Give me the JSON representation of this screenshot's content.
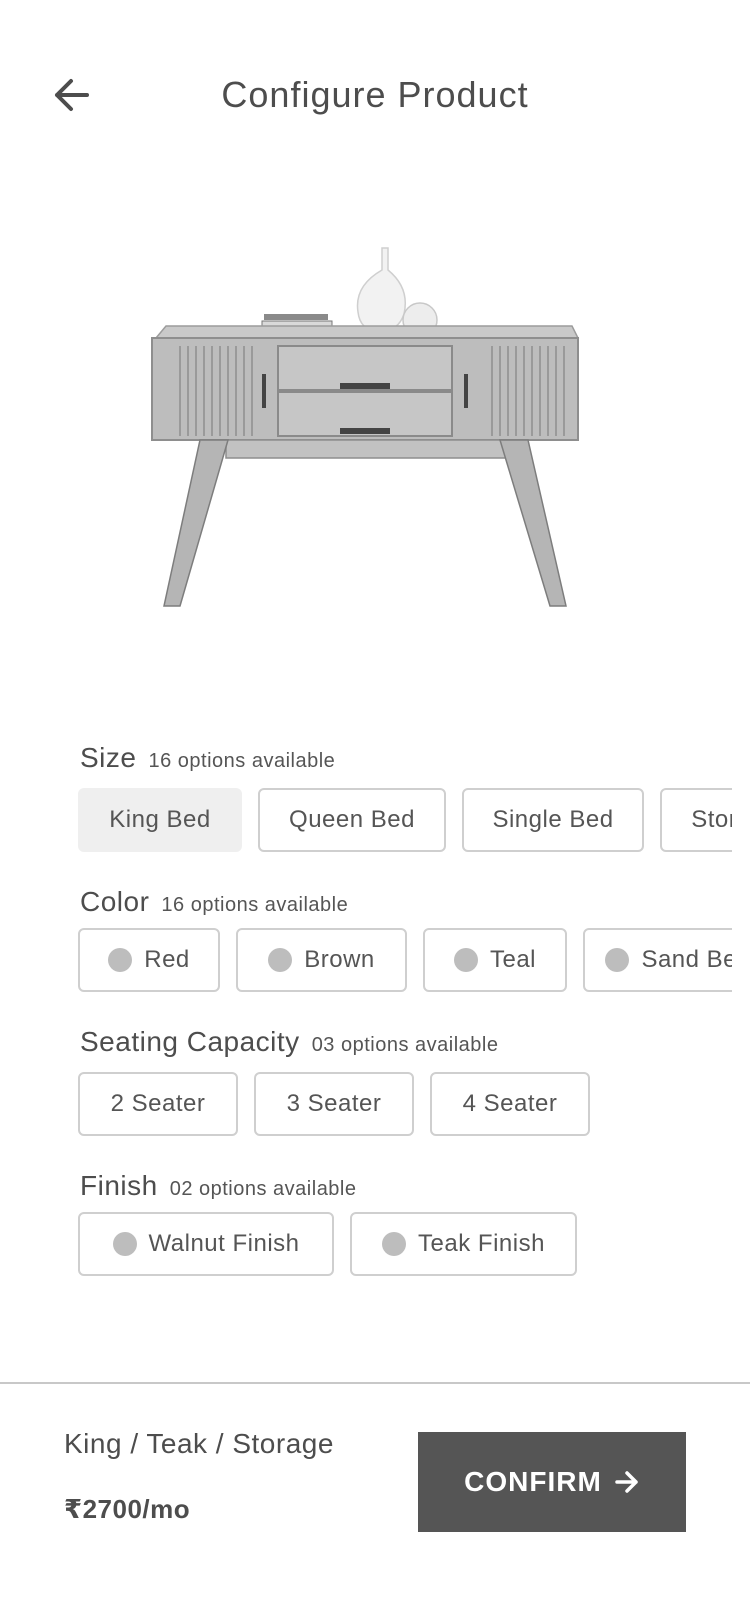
{
  "header": {
    "title": "Configure Product",
    "back_icon": "arrow-left-icon"
  },
  "product": {
    "image_icon": "console-table-image"
  },
  "sections": {
    "size": {
      "title": "Size",
      "count": "16 options available",
      "options": [
        "King Bed",
        "Queen Bed",
        "Single Bed",
        "Storage"
      ],
      "selected": "King Bed"
    },
    "color": {
      "title": "Color",
      "count": "16 options available",
      "options": [
        "Red",
        "Brown",
        "Teal",
        "Sand Beige"
      ]
    },
    "seating": {
      "title": "Seating Capacity",
      "count": "03 options available",
      "options": [
        "2 Seater",
        "3 Seater",
        "4 Seater"
      ]
    },
    "finish": {
      "title": "Finish",
      "count": "02 options available",
      "options": [
        "Walnut Finish",
        "Teak Finish"
      ]
    }
  },
  "footer": {
    "summary": "King / Teak / Storage",
    "price": "₹2700/mo",
    "confirm_label": "CONFIRM",
    "confirm_icon": "arrow-right-icon"
  },
  "colors": {
    "accent": "#555555",
    "selected_bg": "#efefef",
    "border": "#cfcfcf",
    "swatch": "#bdbdbd"
  }
}
